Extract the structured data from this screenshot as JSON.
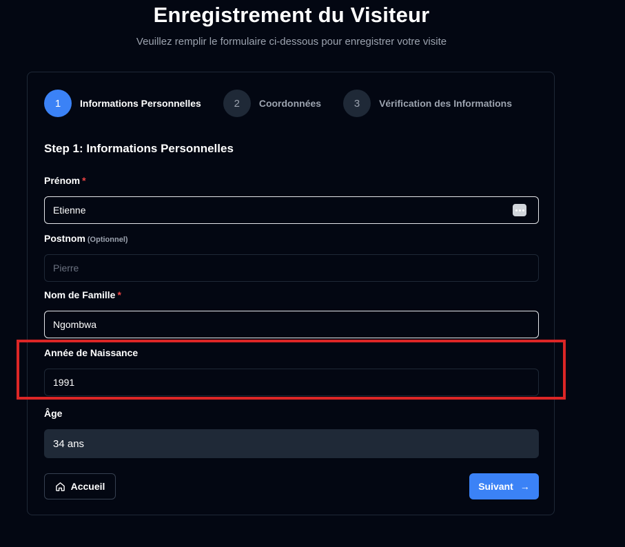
{
  "header": {
    "title": "Enregistrement du Visiteur",
    "subtitle": "Veuillez remplir le formulaire ci-dessous pour enregistrer votre visite"
  },
  "stepper": {
    "steps": [
      {
        "number": "1",
        "label": "Informations Personnelles",
        "active": true
      },
      {
        "number": "2",
        "label": "Coordonnées",
        "active": false
      },
      {
        "number": "3",
        "label": "Vérification des Informations",
        "active": false
      }
    ]
  },
  "form": {
    "heading": "Step 1: Informations Personnelles",
    "first_name": {
      "label": "Prénom",
      "required_mark": "*",
      "value": "Etienne"
    },
    "middle_name": {
      "label": "Postnom",
      "optional_tag": "(Optionnel)",
      "placeholder": "Pierre"
    },
    "last_name": {
      "label": "Nom de Famille",
      "required_mark": "*",
      "value": "Ngombwa"
    },
    "birth_year": {
      "label": "Année de Naissance",
      "value": "1991"
    },
    "age": {
      "label": "Âge",
      "value": "34 ans"
    }
  },
  "actions": {
    "home_label": "Accueil",
    "next_label": "Suivant",
    "next_arrow": "→"
  },
  "colors": {
    "accent": "#3b82f6",
    "background": "#030712",
    "highlight": "#dc2626",
    "required": "#ef4444"
  }
}
